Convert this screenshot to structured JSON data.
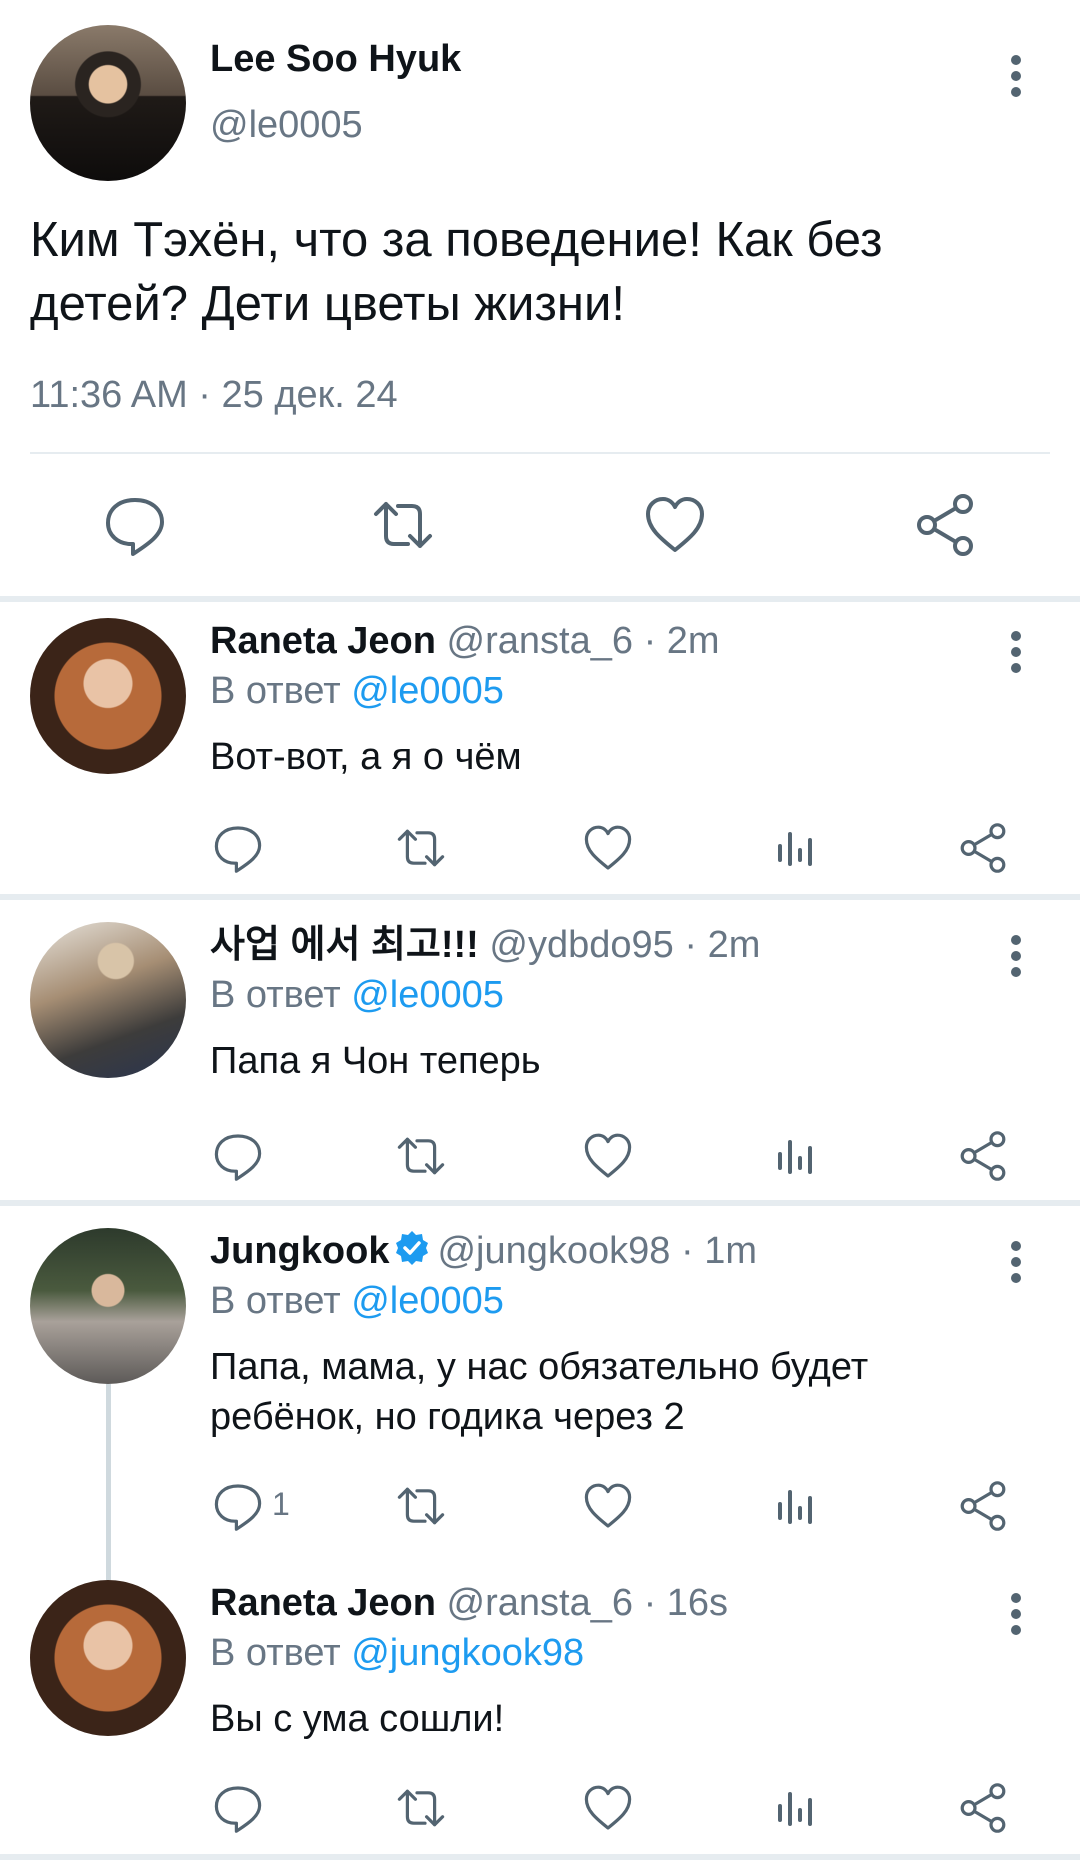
{
  "main_tweet": {
    "author_name": "Lee Soo Hyuk",
    "handle": "@le0005",
    "text": "Ким Тэхён, что за поведение! Как без детей? Дети цветы жизни!",
    "timestamp": "11:36 AM · 25 дек. 24",
    "actions": [
      "reply-icon",
      "retweet-icon",
      "like-icon",
      "share-icon"
    ]
  },
  "replies": [
    {
      "name": "Raneta Jeon",
      "handle": "@ransta_6",
      "time": "· 2m",
      "in_reply_prefix": "В ответ",
      "in_reply_to": "@le0005",
      "text": "Вот-вот, а я о чём",
      "reply_count": ""
    },
    {
      "name": "사업 에서 최고!!!",
      "handle": "@ydbdo95",
      "time": "· 2m",
      "in_reply_prefix": "В ответ",
      "in_reply_to": "@le0005",
      "text": "Папа я Чон теперь",
      "reply_count": ""
    },
    {
      "name": "Jungkook",
      "verified": true,
      "handle": "@jungkook98",
      "time": "· 1m",
      "in_reply_prefix": "В ответ",
      "in_reply_to": "@le0005",
      "text": "Папа, мама, у нас обязательно будет ребёнок, но годика через 2",
      "reply_count": "1"
    },
    {
      "name": "Raneta Jeon",
      "handle": "@ransta_6",
      "time": "· 16s",
      "in_reply_prefix": "В ответ",
      "in_reply_to": "@jungkook98",
      "text": "Вы с ума сошли!",
      "reply_count": ""
    }
  ],
  "colors": {
    "text": "#0f1419",
    "secondary": "#687684",
    "link": "#1d9bf0",
    "divider": "#e6ecf0"
  }
}
